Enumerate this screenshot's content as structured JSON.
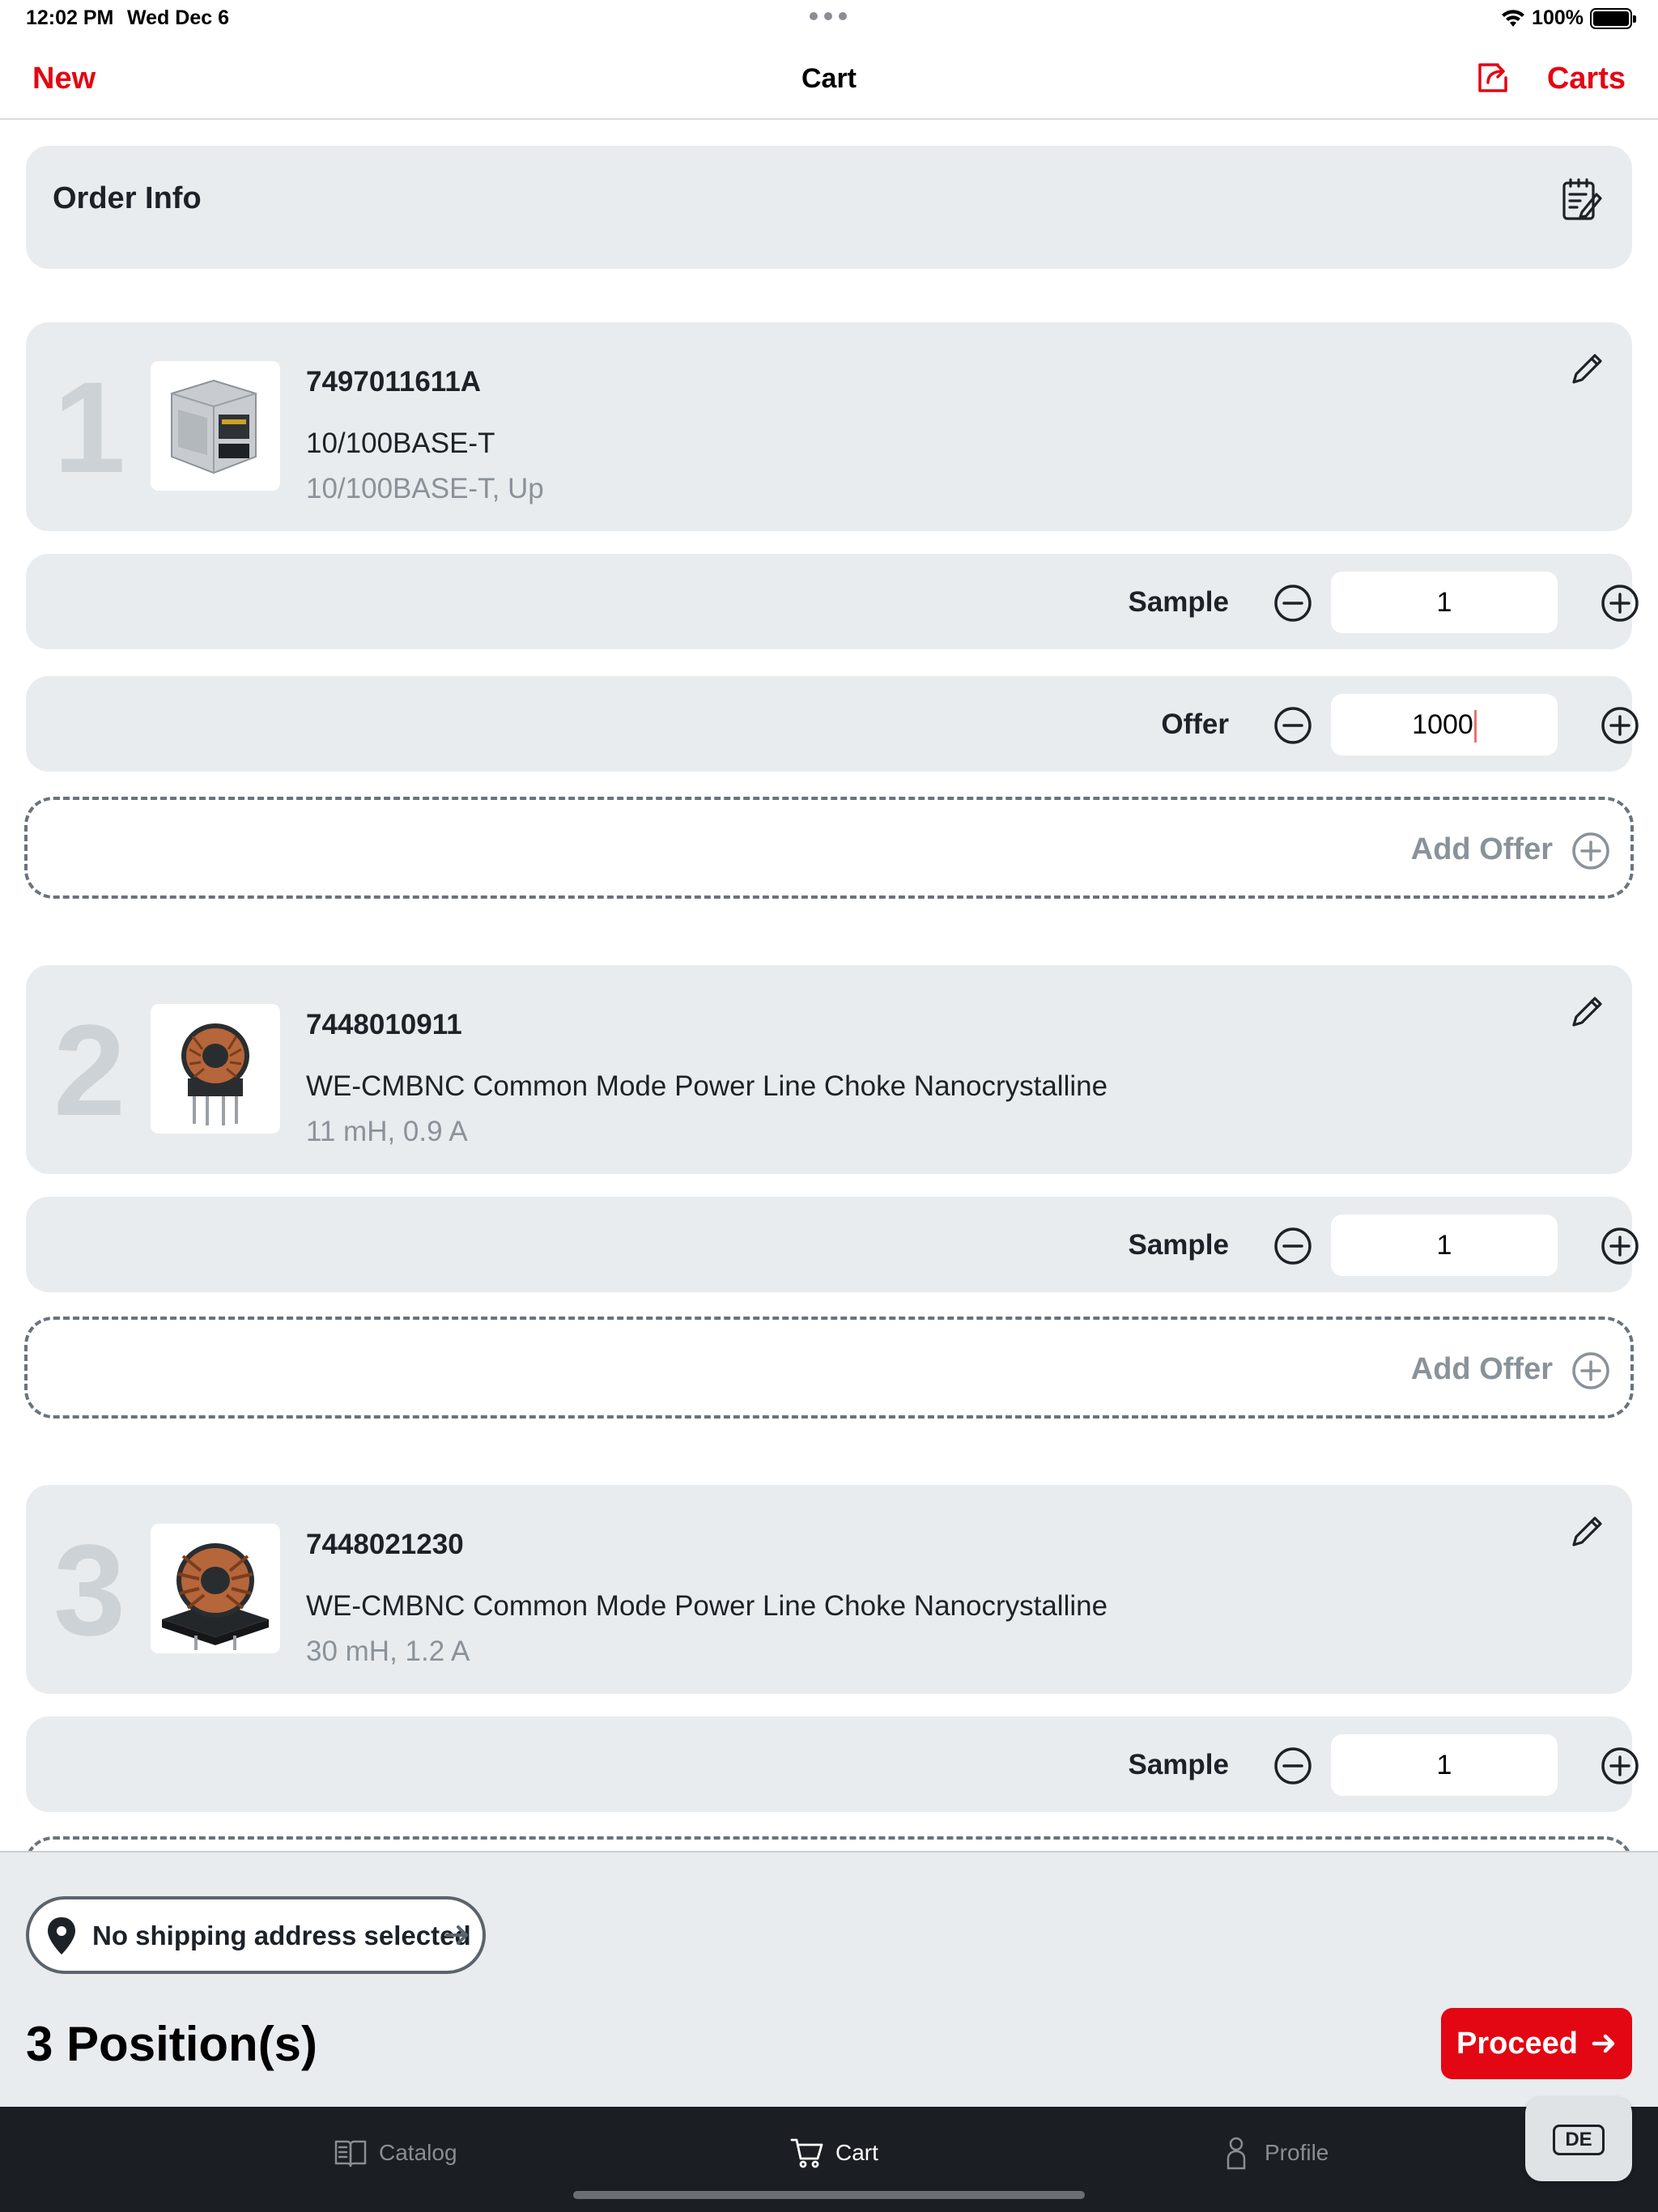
{
  "status_bar": {
    "time": "12:02 PM",
    "date": "Wed Dec 6",
    "battery": "100%"
  },
  "nav": {
    "left_action": "New",
    "title": "Cart",
    "right_action": "Carts",
    "export_icon": "share-export-icon"
  },
  "order_info": {
    "title": "Order Info",
    "icon": "notes-edit-icon"
  },
  "positions": [
    {
      "number": "1",
      "sku": "7497011611A",
      "name": "10/100BASE-T",
      "spec": "10/100BASE-T, Up",
      "image": "rj45-connector",
      "quantities": [
        {
          "label": "Sample",
          "value": "1"
        },
        {
          "label": "Offer",
          "value": "1000"
        }
      ],
      "add_offer": "Add Offer"
    },
    {
      "number": "2",
      "sku": "7448010911",
      "name": "WE-CMBNC Common Mode Power Line Choke Nanocrystalline",
      "spec": "11 mH, 0.9 A",
      "image": "toroid-choke",
      "quantities": [
        {
          "label": "Sample",
          "value": "1"
        }
      ],
      "add_offer": "Add Offer"
    },
    {
      "number": "3",
      "sku": "7448021230",
      "name": "WE-CMBNC Common Mode Power Line Choke Nanocrystalline",
      "spec": "30 mH, 1.2 A",
      "image": "toroid-choke-large",
      "quantities": [
        {
          "label": "Sample",
          "value": "1"
        }
      ]
    }
  ],
  "footer": {
    "shipping": "No shipping address selected",
    "positions_count": "3 Position(s)",
    "proceed": "Proceed"
  },
  "tabs": [
    {
      "label": "Catalog",
      "icon": "book-icon",
      "active": false
    },
    {
      "label": "Cart",
      "icon": "cart-icon",
      "active": true
    },
    {
      "label": "Profile",
      "icon": "person-icon",
      "active": false
    }
  ],
  "language": "DE",
  "colors": {
    "accent": "#e30613",
    "card": "#e9ecee",
    "tabbar": "#1b1f24"
  }
}
